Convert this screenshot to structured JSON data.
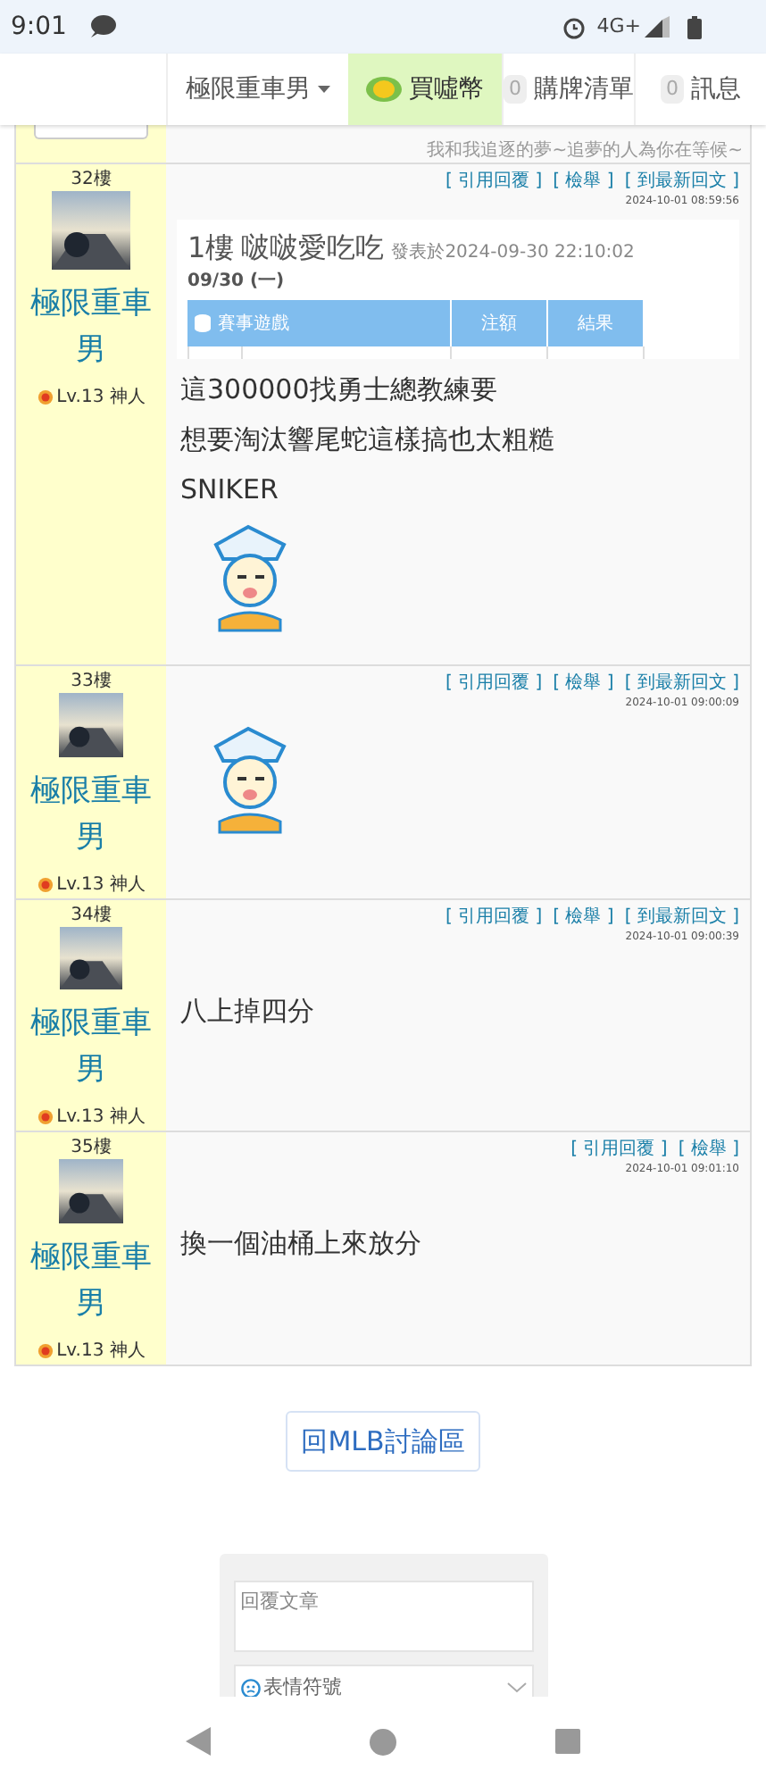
{
  "status_bar": {
    "time": "9:01",
    "network": "4G+"
  },
  "nav": [
    {
      "kind": "user",
      "label": "極限重車男"
    },
    {
      "kind": "coin",
      "label": "買噓幣"
    },
    {
      "kind": "counter",
      "count": "0",
      "label": "購牌清單"
    },
    {
      "kind": "counter",
      "count": "0",
      "label": "訊息"
    }
  ],
  "previous_post": {
    "signature": "我和我追逐的夢~追夢的人為你在等候~"
  },
  "posts": [
    {
      "floor": "32樓",
      "username": "極限重車男",
      "rank": "Lv.13 神人",
      "actions": [
        "[ 引用回覆 ]",
        "[ 檢舉 ]",
        "[ 到最新回文 ]"
      ],
      "timestamp": "2024-10-01 08:59:56",
      "content": [
        {
          "kind": "quote",
          "floor": "1樓",
          "author": "啵啵愛吃吃",
          "posted": "發表於2024-09-30 22:10:02",
          "date": "09/30 (一)",
          "columns": [
            "賽事遊戲",
            "注額",
            "結果"
          ]
        },
        {
          "kind": "text",
          "text": "這300000找勇士總教練要"
        },
        {
          "kind": "text",
          "text": "想要淘汰響尾蛇這樣搞也太粗糙"
        },
        {
          "kind": "text",
          "text": "SNIKER"
        },
        {
          "kind": "sticker"
        }
      ]
    },
    {
      "floor": "33樓",
      "username": "極限重車男",
      "rank": "Lv.13 神人",
      "actions": [
        "[ 引用回覆 ]",
        "[ 檢舉 ]",
        "[ 到最新回文 ]"
      ],
      "timestamp": "2024-10-01 09:00:09",
      "content": [
        {
          "kind": "sticker"
        }
      ]
    },
    {
      "floor": "34樓",
      "username": "極限重車男",
      "rank": "Lv.13 神人",
      "actions": [
        "[ 引用回覆 ]",
        "[ 檢舉 ]",
        "[ 到最新回文 ]"
      ],
      "timestamp": "2024-10-01 09:00:39",
      "content": [
        {
          "kind": "text",
          "text": "八上掉四分"
        }
      ]
    },
    {
      "floor": "35樓",
      "username": "極限重車男",
      "rank": "Lv.13 神人",
      "actions": [
        "[ 引用回覆 ]",
        "[ 檢舉 ]"
      ],
      "timestamp": "2024-10-01 09:01:10",
      "content": [
        {
          "kind": "text",
          "text": "換一個油桶上來放分"
        }
      ]
    }
  ],
  "back_button": "回MLB討論區",
  "reply_form": {
    "placeholder": "回覆文章",
    "emoji_select": "表情符號"
  }
}
